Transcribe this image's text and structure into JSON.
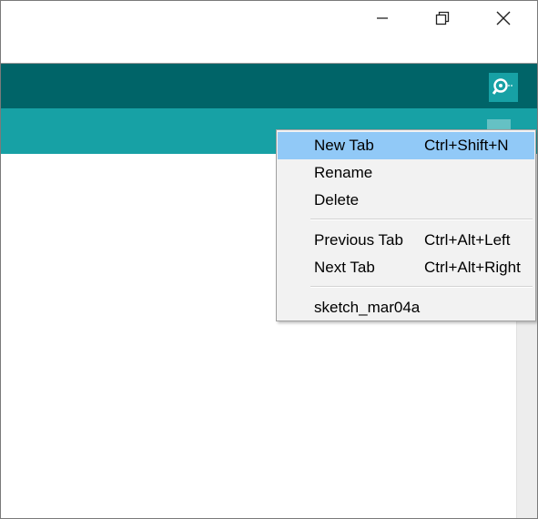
{
  "window": {
    "controls": {
      "minimize_icon": "minimize-icon",
      "maximize_icon": "restore-icon",
      "close_icon": "close-icon"
    }
  },
  "colors": {
    "toolbar": "#006468",
    "tabstrip": "#17a1a5",
    "menu_highlight": "#91c9f7"
  },
  "toolbar": {
    "serial_monitor_icon": "magnifier-icon"
  },
  "tab_menu": {
    "items": [
      {
        "label": "New Tab",
        "shortcut": "Ctrl+Shift+N",
        "highlighted": true
      },
      {
        "label": "Rename",
        "shortcut": ""
      },
      {
        "label": "Delete",
        "shortcut": ""
      },
      {
        "label": "Previous Tab",
        "shortcut": "Ctrl+Alt+Left"
      },
      {
        "label": "Next Tab",
        "shortcut": "Ctrl+Alt+Right"
      },
      {
        "label": "sketch_mar04a",
        "shortcut": ""
      }
    ]
  }
}
